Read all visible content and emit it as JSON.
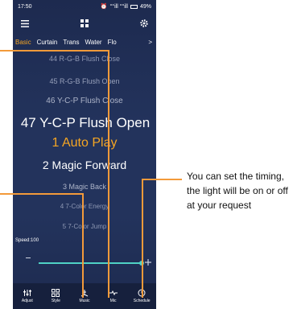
{
  "status_bar": {
    "time": "17:50",
    "signal": "°°ill °°ill",
    "battery": "49%"
  },
  "tabs": [
    {
      "label": "Basic",
      "active": true
    },
    {
      "label": "Curtain",
      "active": false
    },
    {
      "label": "Trans",
      "active": false
    },
    {
      "label": "Water",
      "active": false
    },
    {
      "label": "Flo",
      "active": false
    }
  ],
  "tab_more": ">",
  "modes": [
    "44 R-G-B Flush Close",
    "45 R-G-B Flush Open",
    "46 Y-C-P Flush Close",
    "47 Y-C-P Flush Open",
    "1 Auto Play",
    "2 Magic Forward",
    "3 Magic Back",
    "4 7-Color Energy",
    "5 7-Color Jump"
  ],
  "speed": {
    "label": "Speed:100",
    "value": 100,
    "max": 100
  },
  "bottom_nav": [
    {
      "label": "Adjust",
      "icon": "adjust-icon"
    },
    {
      "label": "Style",
      "icon": "style-icon"
    },
    {
      "label": "Music",
      "icon": "music-icon"
    },
    {
      "label": "Mic",
      "icon": "mic-icon"
    },
    {
      "label": "Schedule",
      "icon": "schedule-icon"
    }
  ],
  "caption": "You can set the timing, the light will be on or off at your request",
  "colors": {
    "accent": "#f5a623",
    "callout": "#f39a3a",
    "slider": "#4fd1c5",
    "background": "#23335c"
  }
}
